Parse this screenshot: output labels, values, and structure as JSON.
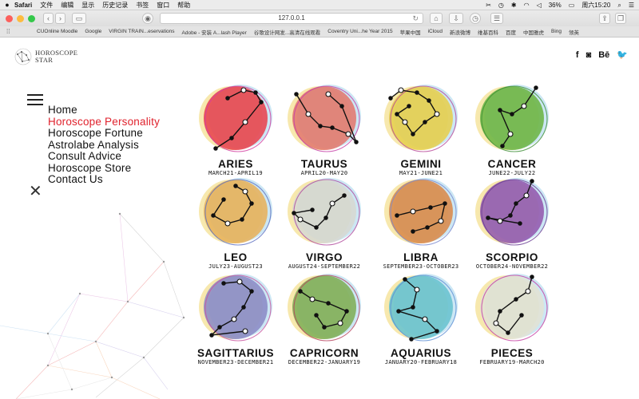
{
  "menubar": {
    "apple": "",
    "items": [
      "Safari",
      "文件",
      "编辑",
      "显示",
      "历史记录",
      "书签",
      "窗口",
      "帮助"
    ],
    "battery": "36%",
    "clock": "周六15:20"
  },
  "browser": {
    "url": "127.0.0.1"
  },
  "bookmarks": [
    "CUOnline Moodle",
    "Google",
    "VIRGIN TRAIN...eservations",
    "Adobe - 安装 A...lash Player",
    "谷歌设计网发...高清在线观看",
    "Coventry Uni...he Year 2015",
    "苹果中国",
    "iCloud",
    "新浪微博",
    "维基百科",
    "百度",
    "中国雅虎",
    "Bing",
    "领英"
  ],
  "site": {
    "logo_line1": "HOROSCOPE",
    "logo_line2": "STAR",
    "social": [
      "f",
      "◙",
      "Bē",
      "🐦"
    ]
  },
  "nav": [
    {
      "label": "Home",
      "active": false
    },
    {
      "label": "Horoscope Personality",
      "active": true
    },
    {
      "label": "Horoscope Fortune",
      "active": false
    },
    {
      "label": "Astrolabe Analysis",
      "active": false
    },
    {
      "label": "Consult Advice",
      "active": false
    },
    {
      "label": "Horoscope Store",
      "active": false
    },
    {
      "label": "Contact Us",
      "active": false
    }
  ],
  "signs": [
    {
      "name": "ARIES",
      "dates": "MARCH21-APRIL19",
      "color": "#e8434f",
      "ring": "#d33ea0"
    },
    {
      "name": "TAURUS",
      "dates": "APRIL20-MAY20",
      "color": "#e3796f",
      "ring": "#c640a8"
    },
    {
      "name": "GEMINI",
      "dates": "MAY21-JUNE21",
      "color": "#e6cf4e",
      "ring": "#b8499a"
    },
    {
      "name": "CANCER",
      "dates": "JUNE22-JULY22",
      "color": "#6cb544",
      "ring": "#3d8f36"
    },
    {
      "name": "LEO",
      "dates": "JULY23-AUGUST23",
      "color": "#e7b25c",
      "ring": "#5d6fc0"
    },
    {
      "name": "VIRGO",
      "dates": "AUGUST24-SEPTEMBER22",
      "color": "#d7d8d2",
      "ring": "#b04a9c"
    },
    {
      "name": "LIBRA",
      "dates": "SEPTEMBER23-OCTOBER23",
      "color": "#d98a4b",
      "ring": "#7a8ad0"
    },
    {
      "name": "SCORPIO",
      "dates": "OCTOBER24-NOVEMBER22",
      "color": "#9359ae",
      "ring": "#6a3f94"
    },
    {
      "name": "SAGITTARIUS",
      "dates": "NOVEMBER23-DECEMBER21",
      "color": "#8b8bc6",
      "ring": "#c9559f"
    },
    {
      "name": "CAPRICORN",
      "dates": "DECEMBER22-JANUARY19",
      "color": "#7fae58",
      "ring": "#b7435e"
    },
    {
      "name": "AQUARIUS",
      "dates": "JANUARY20-FEBRUARY18",
      "color": "#69c3cf",
      "ring": "#5d8fd4"
    },
    {
      "name": "PIECES",
      "dates": "FEBRUARY19-MARCH20",
      "color": "#e3e2d4",
      "ring": "#c63fa2"
    }
  ]
}
